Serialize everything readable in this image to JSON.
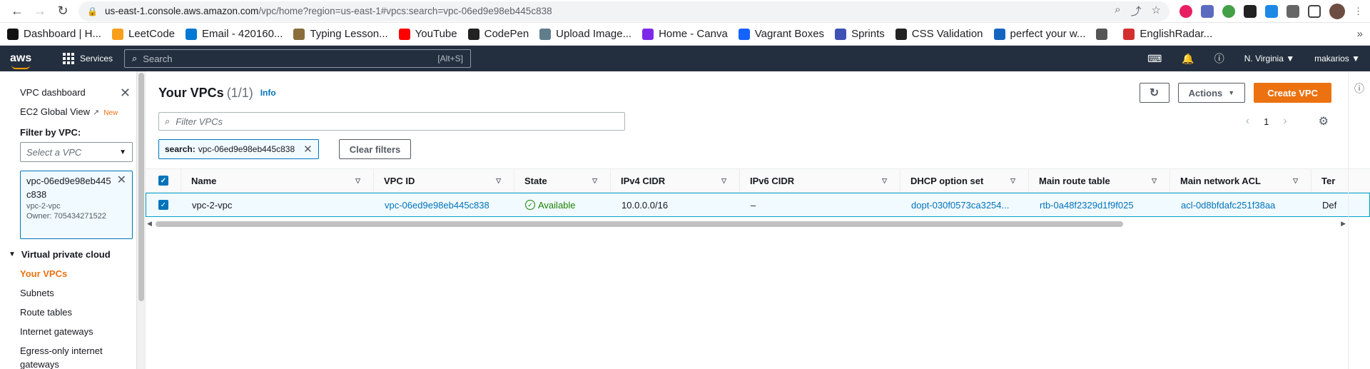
{
  "browser": {
    "url_host": "us-east-1.console.aws.amazon.com",
    "url_path": "/vpc/home?region=us-east-1#vpcs:search=vpc-06ed9e98eb445c838"
  },
  "bookmarks": [
    {
      "label": "Dashboard | H...",
      "color": "#111"
    },
    {
      "label": "LeetCode",
      "color": "#f89f1b"
    },
    {
      "label": "Email - 420160...",
      "color": "#0078d4"
    },
    {
      "label": "Typing Lesson...",
      "color": "#8a6d3b"
    },
    {
      "label": "YouTube",
      "color": "#ff0000"
    },
    {
      "label": "CodePen",
      "color": "#222"
    },
    {
      "label": "Upload Image...",
      "color": "#607d8b"
    },
    {
      "label": "Home - Canva",
      "color": "#7d2ae8"
    },
    {
      "label": "Vagrant Boxes",
      "color": "#1563ff"
    },
    {
      "label": "Sprints",
      "color": "#3f51b5"
    },
    {
      "label": "CSS Validation",
      "color": "#222"
    },
    {
      "label": "perfect your w...",
      "color": "#1565c0"
    },
    {
      "label": "",
      "color": "#555"
    },
    {
      "label": "EnglishRadar...",
      "color": "#d32f2f"
    }
  ],
  "awsnav": {
    "logo": "aws",
    "services_label": "Services",
    "search_placeholder": "Search",
    "search_shortcut": "[Alt+S]",
    "region": "N. Virginia ▼",
    "user": "makarios ▼"
  },
  "sidebar": {
    "dashboard": "VPC dashboard",
    "ec2_global": "EC2 Global View",
    "new_badge": "New",
    "filter_label": "Filter by VPC:",
    "select_placeholder": "Select a VPC",
    "token_id": "vpc-06ed9e98eb445c838",
    "token_name": "vpc-2-vpc",
    "token_owner": "Owner: 705434271522",
    "section": "Virtual private cloud",
    "links": [
      "Your VPCs",
      "Subnets",
      "Route tables",
      "Internet gateways",
      "Egress-only internet gateways"
    ]
  },
  "page": {
    "title": "Your VPCs",
    "count": "(1/1)",
    "info": "Info",
    "actions_label": "Actions",
    "create_label": "Create VPC",
    "filter_placeholder": "Filter VPCs",
    "page_number": "1",
    "chip_key": "search:",
    "chip_value": "vpc-06ed9e98eb445c838",
    "clear_filters": "Clear filters"
  },
  "table": {
    "columns": [
      "Name",
      "VPC ID",
      "State",
      "IPv4 CIDR",
      "IPv6 CIDR",
      "DHCP option set",
      "Main route table",
      "Main network ACL",
      "Ter"
    ],
    "row": {
      "name": "vpc-2-vpc",
      "vpc_id": "vpc-06ed9e98eb445c838",
      "state": "Available",
      "ipv4": "10.0.0.0/16",
      "ipv6": "–",
      "dhcp": "dopt-030f0573ca3254...",
      "route_table": "rtb-0a48f2329d1f9f025",
      "acl": "acl-0d8bfdafc251f38aa",
      "tenancy": "Def"
    }
  }
}
